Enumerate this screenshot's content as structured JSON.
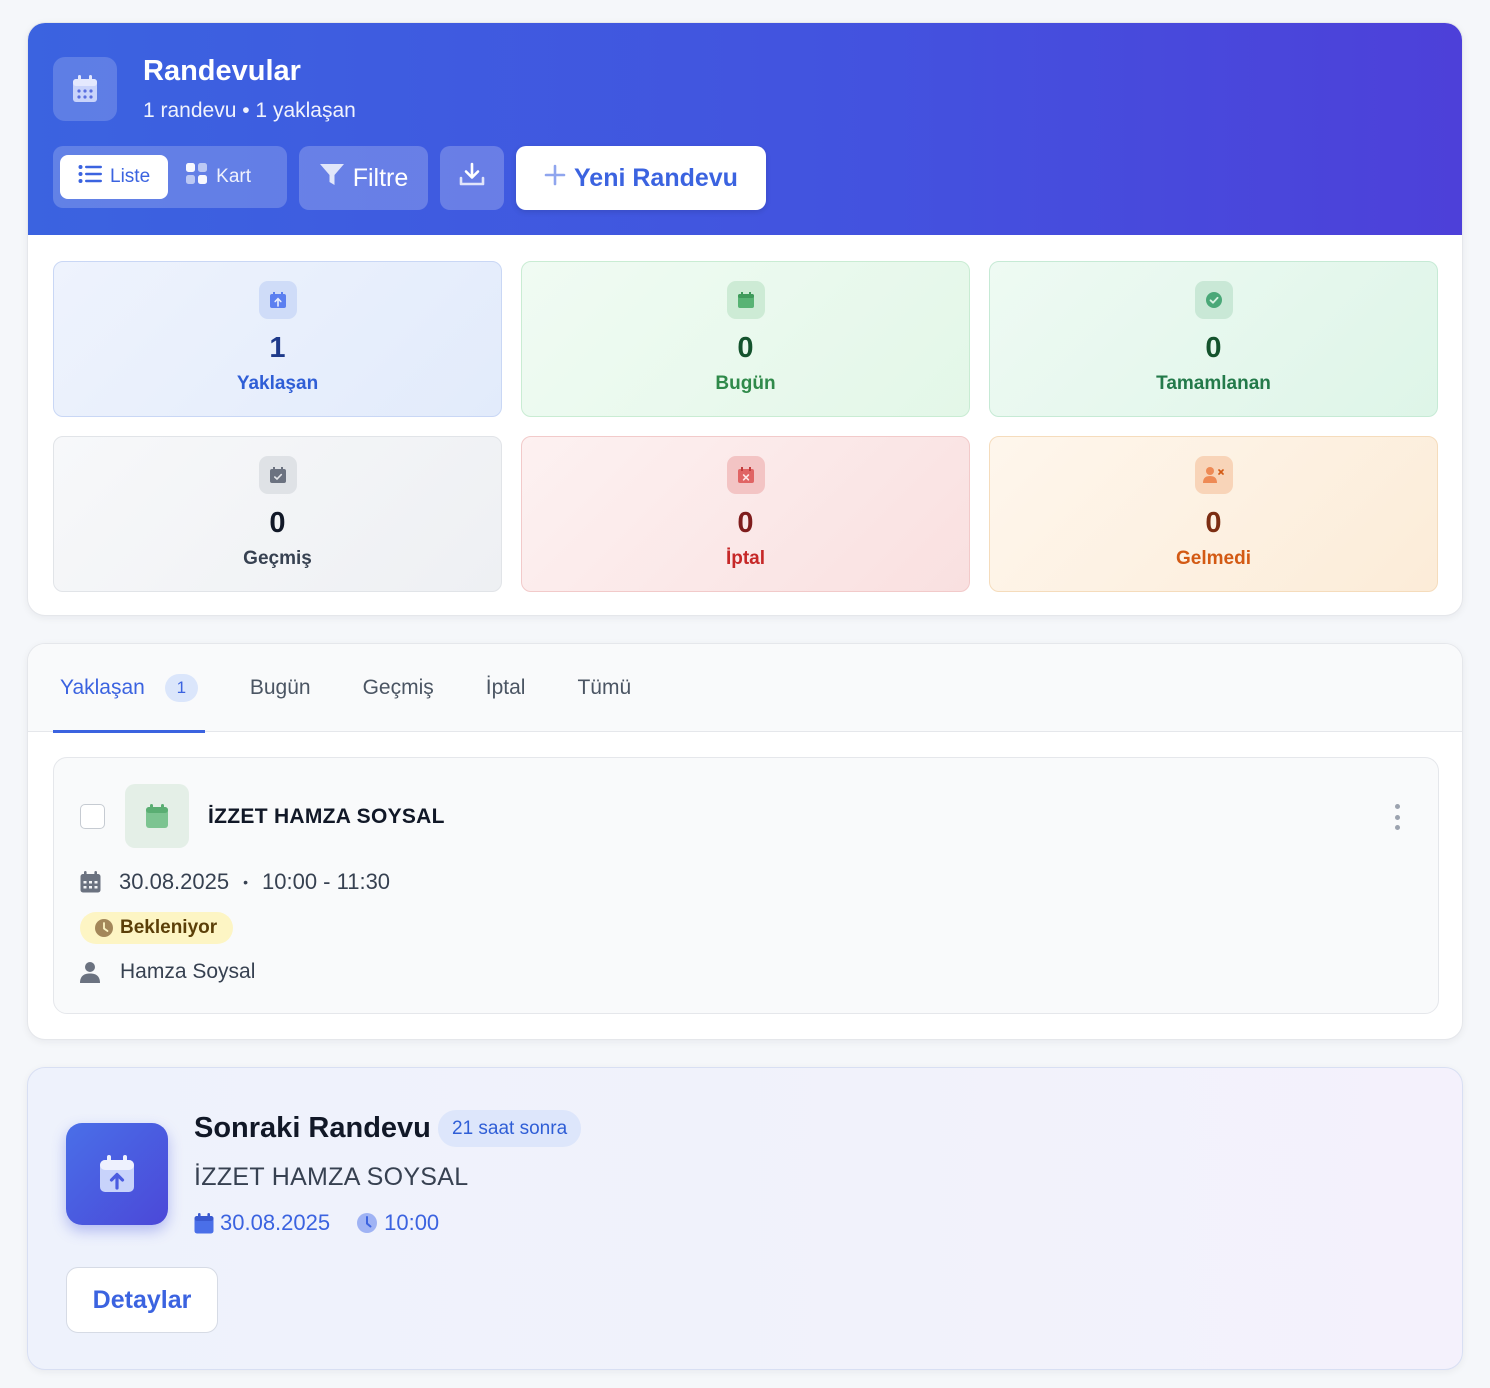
{
  "header": {
    "title": "Randevular",
    "subtitle": "1 randevu • 1 yaklaşan",
    "view_list_label": "Liste",
    "view_card_label": "Kart",
    "filter_label": "Filtre",
    "new_label": "Yeni Randevu",
    "active_view": "list"
  },
  "stats": [
    {
      "value": "1",
      "label": "Yaklaşan",
      "icon": "calendar-arrow-up-icon"
    },
    {
      "value": "0",
      "label": "Bugün",
      "icon": "calendar-icon"
    },
    {
      "value": "0",
      "label": "Tamamlanan",
      "icon": "check-circle-icon"
    },
    {
      "value": "0",
      "label": "Geçmiş",
      "icon": "calendar-check-icon"
    },
    {
      "value": "0",
      "label": "İptal",
      "icon": "calendar-x-icon"
    },
    {
      "value": "0",
      "label": "Gelmedi",
      "icon": "user-x-icon"
    }
  ],
  "tabs": [
    {
      "label": "Yaklaşan",
      "count": "1",
      "active": true
    },
    {
      "label": "Bugün"
    },
    {
      "label": "Geçmiş"
    },
    {
      "label": "İptal"
    },
    {
      "label": "Tümü"
    }
  ],
  "appointments": [
    {
      "name": "İZZET HAMZA SOYSAL",
      "date": "30.08.2025",
      "separator": "•",
      "time": "10:00 - 11:30",
      "status": "Bekleniyor",
      "person": "Hamza Soysal"
    }
  ],
  "next": {
    "title": "Sonraki Randevu",
    "badge": "21 saat sonra",
    "name": "İZZET HAMZA SOYSAL",
    "date": "30.08.2025",
    "time": "10:00",
    "details_label": "Detaylar"
  },
  "colors": {
    "accent": "#3b63e0",
    "hero_gradient_start": "#3b63e0",
    "hero_gradient_end": "#4d40d9",
    "status_pending_bg": "#fdf5c4"
  }
}
